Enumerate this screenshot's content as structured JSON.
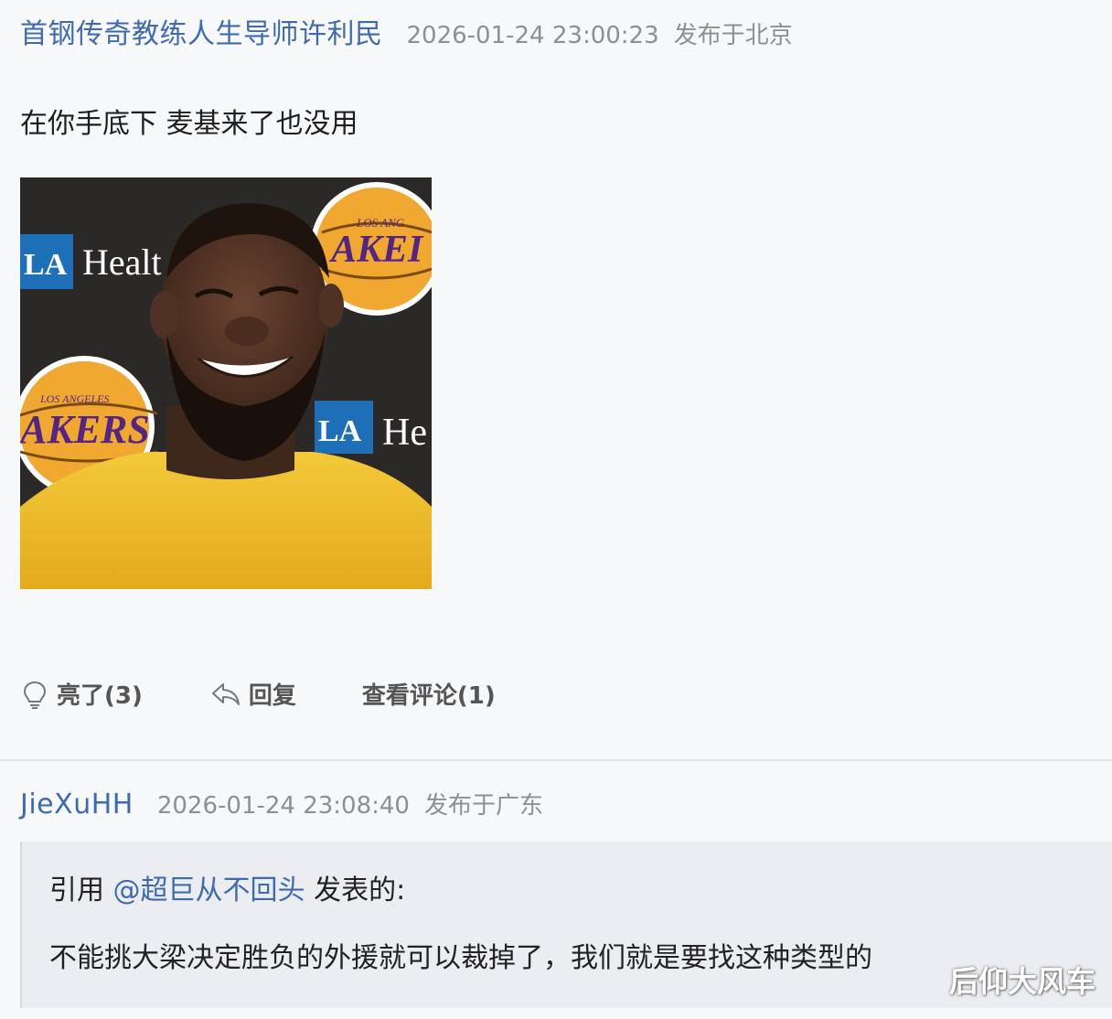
{
  "post1": {
    "author": "首钢传奇教练人生导师许利民",
    "time": "2026-01-24 23:00:23",
    "location": "发布于北京",
    "text": "在你手底下 麦基来了也没用",
    "photo": {
      "banner_left": "LA",
      "banner_left_text": "Healt",
      "logo_top_small": "LOS ANG",
      "logo_top": "AKEI",
      "logo_left_small": "LOS ANGELES",
      "logo_left": "AKERS",
      "banner_right": "LA",
      "banner_right_text": "He"
    },
    "actions": {
      "like": "亮了(3)",
      "reply": "回复",
      "comments": "查看评论(1)"
    }
  },
  "post2": {
    "author": "JieXuHH",
    "time": "2026-01-24 23:08:40",
    "location": "发布于广东",
    "quote": {
      "prefix": "引用 ",
      "mention": "@超巨从不回头",
      "suffix": " 发表的:",
      "body": "不能挑大梁决定胜负的外援就可以裁掉了，我们就是要找这种类型的"
    }
  },
  "watermark": "后仰大风车",
  "colors": {
    "link": "#3e6bb0",
    "meta": "#8c8f94",
    "quote_bg": "#ebedf0",
    "jersey": "#f2c12e",
    "lakers_purple": "#552583",
    "lakers_gold": "#f0a830"
  }
}
